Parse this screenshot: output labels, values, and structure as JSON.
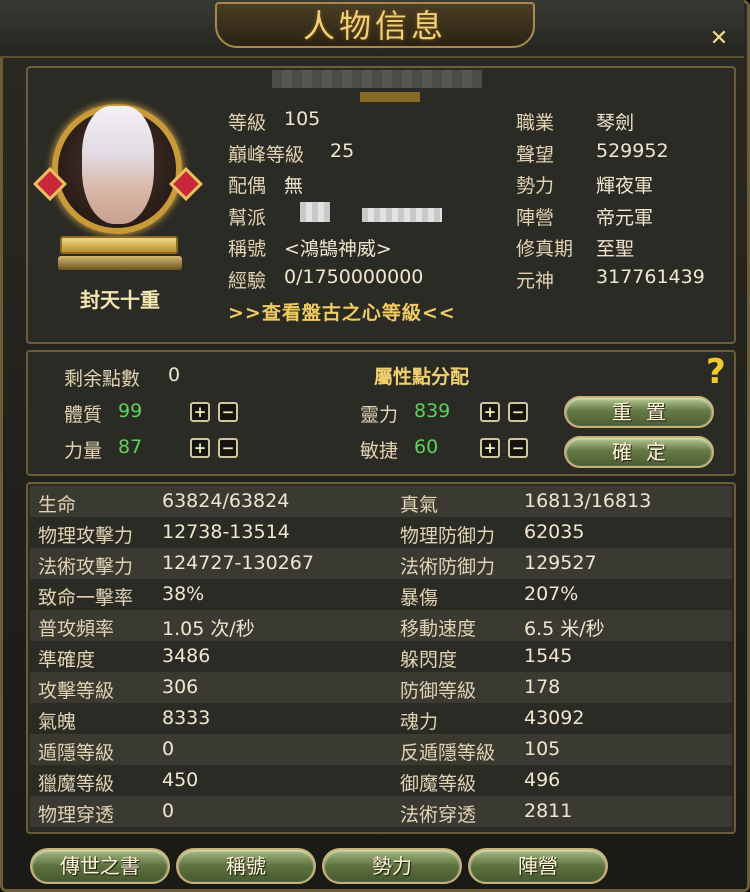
{
  "window": {
    "title": "人物信息",
    "close_glyph": "✕"
  },
  "profile": {
    "rank_title": "封天十重",
    "left": [
      {
        "label": "等級",
        "value": "105"
      },
      {
        "label": "巔峰等級",
        "value": "25"
      },
      {
        "label": "配偶",
        "value": "無"
      },
      {
        "label": "幫派",
        "value": ""
      },
      {
        "label": "稱號",
        "value": "<鴻鵠神威>"
      },
      {
        "label": "經驗",
        "value": "0/1750000000"
      }
    ],
    "right": [
      {
        "label": "職業",
        "value": "琴劍"
      },
      {
        "label": "聲望",
        "value": "529952"
      },
      {
        "label": "勢力",
        "value": "輝夜軍"
      },
      {
        "label": "陣營",
        "value": "帝元軍"
      },
      {
        "label": "修真期",
        "value": "至聖"
      },
      {
        "label": "元神",
        "value": "317761439"
      }
    ],
    "pangu_link": ">>查看盤古之心等級<<"
  },
  "attributes": {
    "title": "屬性點分配",
    "remaining_label": "剩余點數",
    "remaining_value": "0",
    "stats": [
      {
        "label": "體質",
        "value": "99"
      },
      {
        "label": "力量",
        "value": "87"
      },
      {
        "label": "靈力",
        "value": "839"
      },
      {
        "label": "敏捷",
        "value": "60"
      }
    ],
    "plus": "+",
    "minus": "−",
    "reset_label": "重置",
    "confirm_label": "確定",
    "help_glyph": "?"
  },
  "stats_table": {
    "left": [
      {
        "label": "生命",
        "value": "63824/63824"
      },
      {
        "label": "物理攻擊力",
        "value": "12738-13514"
      },
      {
        "label": "法術攻擊力",
        "value": "124727-130267"
      },
      {
        "label": "致命一擊率",
        "value": "38%"
      },
      {
        "label": "普攻頻率",
        "value": "1.05 次/秒"
      },
      {
        "label": "準確度",
        "value": "3486"
      },
      {
        "label": "攻擊等級",
        "value": "306"
      },
      {
        "label": "氣魄",
        "value": "8333"
      },
      {
        "label": "遁隱等級",
        "value": "0"
      },
      {
        "label": "獵魔等級",
        "value": "450"
      },
      {
        "label": "物理穿透",
        "value": "0"
      }
    ],
    "right": [
      {
        "label": "真氣",
        "value": "16813/16813"
      },
      {
        "label": "物理防御力",
        "value": "62035"
      },
      {
        "label": "法術防御力",
        "value": "129527"
      },
      {
        "label": "暴傷",
        "value": "207%"
      },
      {
        "label": "移動速度",
        "value": "6.5 米/秒"
      },
      {
        "label": "躲閃度",
        "value": "1545"
      },
      {
        "label": "防御等級",
        "value": "178"
      },
      {
        "label": "魂力",
        "value": "43092"
      },
      {
        "label": "反遁隱等級",
        "value": "105"
      },
      {
        "label": "御魔等級",
        "value": "496"
      },
      {
        "label": "法術穿透",
        "value": "2811"
      }
    ]
  },
  "bottom_buttons": [
    "傳世之書",
    "稱號",
    "勢力",
    "陣營"
  ],
  "colors": {
    "accent_gold": "#f0cf7a",
    "stat_green": "#5ed05e",
    "button_green": "#5e7240"
  }
}
